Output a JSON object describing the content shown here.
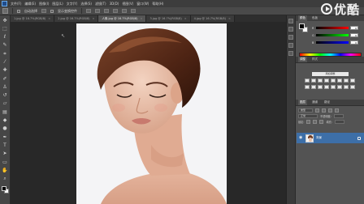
{
  "menu": {
    "items": [
      "文件(F)",
      "编辑(E)",
      "图像(I)",
      "图层(L)",
      "文字(Y)",
      "选择(S)",
      "滤镜(T)",
      "3D(D)",
      "视图(V)",
      "窗口(W)",
      "帮助(H)"
    ]
  },
  "options_bar": {
    "auto_select_label": "自动选择",
    "show_transform_label": "显示变换控件"
  },
  "watermark": {
    "text": "优酷"
  },
  "document_tabs": [
    {
      "label": "1.jpg @ 16.7%(RGB/8)",
      "active": false
    },
    {
      "label": "2.jpg @ 16.7%(RGB/8)",
      "active": false
    },
    {
      "label": "人像.jpg @ 16.7%(RGB/8)",
      "active": true
    },
    {
      "label": "3.jpg @ 16.7%(RGB/8)",
      "active": false
    },
    {
      "label": "4.jpg @ 16.7%(RGB/8)",
      "active": false
    }
  ],
  "tools": [
    "move-tool",
    "marquee-tool",
    "lasso-tool",
    "quick-select-tool",
    "crop-tool",
    "eyedropper-tool",
    "healing-brush-tool",
    "brush-tool",
    "clone-stamp-tool",
    "history-brush-tool",
    "eraser-tool",
    "gradient-tool",
    "blur-tool",
    "dodge-tool",
    "pen-tool",
    "type-tool",
    "path-select-tool",
    "shape-tool",
    "hand-tool",
    "zoom-tool"
  ],
  "colors": {
    "foreground": "#000000",
    "background": "#ffffff",
    "layer_selected": "#3d6fa8"
  },
  "color_panel": {
    "tabs": [
      "颜色",
      "色板"
    ],
    "channels": [
      {
        "name": "R",
        "value": "0"
      },
      {
        "name": "G",
        "value": "0"
      },
      {
        "name": "B",
        "value": "0"
      }
    ]
  },
  "adjustments_panel": {
    "tabs": [
      "调整",
      "样式"
    ],
    "title": "添加调整"
  },
  "layers_panel": {
    "tabs": [
      "图层",
      "通道",
      "路径"
    ],
    "kind_label": "类型",
    "blend_mode": "正常",
    "opacity_label": "不透明度:",
    "lock_label": "锁定:",
    "fill_label": "填充:",
    "layers": [
      {
        "name": "背景",
        "visible": true,
        "locked": true
      }
    ]
  }
}
